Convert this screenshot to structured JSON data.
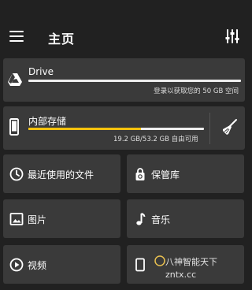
{
  "appbar": {
    "title": "主页"
  },
  "drive": {
    "label": "Drive",
    "subtitle": "登录以获取您的 50 GB 空间"
  },
  "storage": {
    "label": "内部存储",
    "usage_text": "19.2 GB/53.2 GB 自由可用",
    "used_fraction": 0.64
  },
  "tiles": [
    {
      "label": "最近使用的文件",
      "icon": "clock-icon"
    },
    {
      "label": "保管库",
      "icon": "vault-lock-icon"
    },
    {
      "label": "图片",
      "icon": "image-icon"
    },
    {
      "label": "音乐",
      "icon": "music-note-icon"
    },
    {
      "label": "视频",
      "icon": "play-circle-icon"
    },
    {
      "label": "",
      "icon": "app-icon"
    }
  ],
  "watermark": {
    "line1": "八神智能天下",
    "line2": "zntx.cc"
  },
  "colors": {
    "background": "#212121",
    "card": "#3a3a3a",
    "storage_fill": "#f4c20d"
  }
}
